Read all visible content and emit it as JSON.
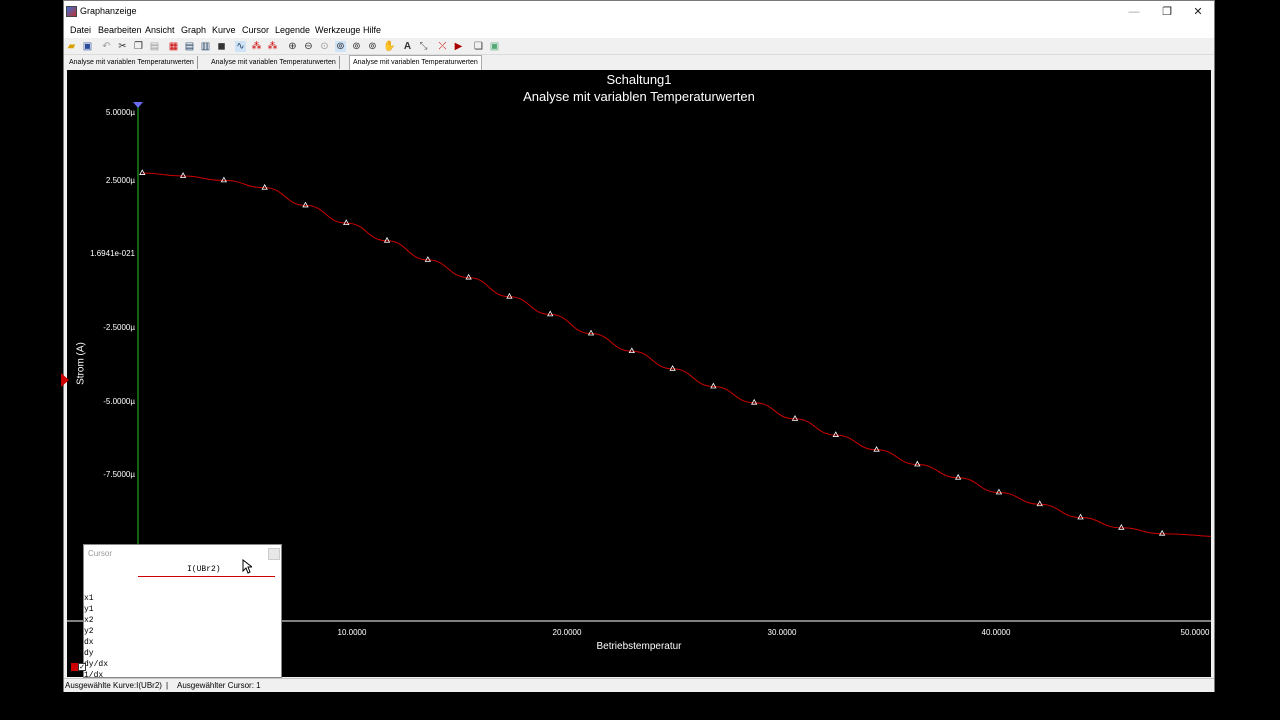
{
  "window": {
    "title": "Graphanzeige",
    "minimize": "—",
    "restore": "❐",
    "close": "✕"
  },
  "menu": [
    "Datei",
    "Bearbeiten",
    "Ansicht",
    "Graph",
    "Kurve",
    "Cursor",
    "Legende",
    "Werkzeuge",
    "Hilfe"
  ],
  "toolbar_icons": [
    "open-icon",
    "save-icon",
    "undo-icon",
    "cut-icon",
    "copy-icon",
    "paste-icon",
    "grid-icon",
    "legend-icon",
    "bar-icon",
    "dark-bg-icon",
    "line-icon",
    "cursor-icon",
    "cursor2-icon",
    "zoom-in-icon",
    "zoom-out-icon",
    "zoom-fit-icon",
    "zoom-x-icon",
    "zoom-y-icon",
    "zoom-area-icon",
    "pan-icon",
    "text-icon",
    "axis-icon",
    "curve-icon",
    "props-icon",
    "copy-graph-icon",
    "export-icon"
  ],
  "tabs": [
    "Analyse mit variablen Temperaturwerten",
    "Analyse mit variablen Temperaturwerten",
    "Analyse mit variablen Temperaturwerten"
  ],
  "graph": {
    "title": "Schaltung1",
    "subtitle": "Analyse mit variablen Temperaturwerten",
    "ylabel": "Strom (A)",
    "xlabel": "Betriebstemperatur",
    "yticks": [
      "5.0000µ",
      "2.5000µ",
      "1.6941e-021",
      "-2.5000µ",
      "-5.0000µ",
      "-7.5000µ"
    ],
    "xticks": [
      "10.0000",
      "20.0000",
      "30.0000",
      "40.0000",
      "50.0000"
    ]
  },
  "chart_data": {
    "type": "line",
    "title": "Schaltung1",
    "subtitle": "Analyse mit variablen Temperaturwerten",
    "xlabel": "Betriebstemperatur",
    "ylabel": "Strom (A)",
    "xlim": [
      0,
      50.7
    ],
    "ylim": [
      -12.45,
      5.0
    ],
    "y_unit": "µA",
    "series": [
      {
        "name": "I(UBr2)",
        "color": "#cc0000",
        "x": [
          0.2,
          2.1,
          4.0,
          5.9,
          7.8,
          9.7,
          11.6,
          13.5,
          15.4,
          17.3,
          19.2,
          21.1,
          23.0,
          24.9,
          26.8,
          28.7,
          30.6,
          32.5,
          34.4,
          36.3,
          38.2,
          40.1,
          42.0,
          43.9,
          45.8,
          47.7,
          50.6
        ],
        "y": [
          2.75,
          2.65,
          2.5,
          2.25,
          1.65,
          1.05,
          0.45,
          -0.2,
          -0.8,
          -1.45,
          -2.05,
          -2.7,
          -3.3,
          -3.9,
          -4.5,
          -5.05,
          -5.6,
          -6.15,
          -6.65,
          -7.15,
          -7.6,
          -8.1,
          -8.5,
          -8.95,
          -9.3,
          -9.5,
          -9.6
        ]
      }
    ]
  },
  "cursor_panel": {
    "title": "Cursor",
    "column": "I(UBr2)",
    "rows": [
      "x1",
      "y1",
      "x2",
      "y2",
      "dx",
      "dy",
      "dy/dx",
      "1/dx"
    ]
  },
  "status": {
    "curve": "Ausgewählte Kurve:I(UBr2)",
    "sep": "|",
    "cursor": "Ausgewählter Cursor: 1"
  }
}
